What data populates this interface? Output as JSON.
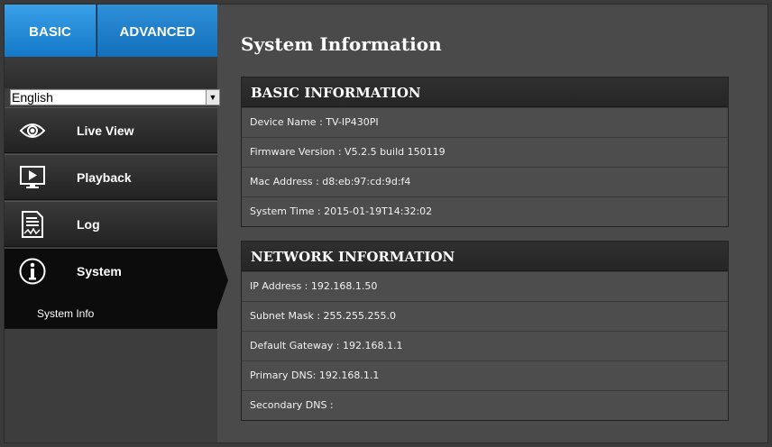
{
  "tabs": {
    "basic": "BASIC",
    "advanced": "ADVANCED"
  },
  "language": {
    "selected": "English"
  },
  "menu": {
    "items": [
      {
        "label": "Live View",
        "icon": "eye-icon"
      },
      {
        "label": "Playback",
        "icon": "playback-icon"
      },
      {
        "label": "Log",
        "icon": "log-icon"
      },
      {
        "label": "System",
        "icon": "info-icon"
      }
    ],
    "submenu": "System Info"
  },
  "page": {
    "title": "System Information"
  },
  "basic_info": {
    "header": "BASIC INFORMATION",
    "rows": [
      "Device Name : TV-IP430PI",
      "Firmware Version : V5.2.5 build 150119",
      "Mac Address : d8:eb:97:cd:9d:f4",
      "System Time : 2015-01-19T14:32:02"
    ]
  },
  "network_info": {
    "header": "NETWORK INFORMATION",
    "rows": [
      "IP Address : 192.168.1.50",
      "Subnet Mask : 255.255.255.0",
      "Default Gateway : 192.168.1.1",
      "Primary DNS: 192.168.1.1",
      "Secondary DNS :"
    ]
  },
  "colors": {
    "accent": "#1a7fd0",
    "background": "#4a4a4a",
    "panel_header": "#2b2b2b"
  }
}
